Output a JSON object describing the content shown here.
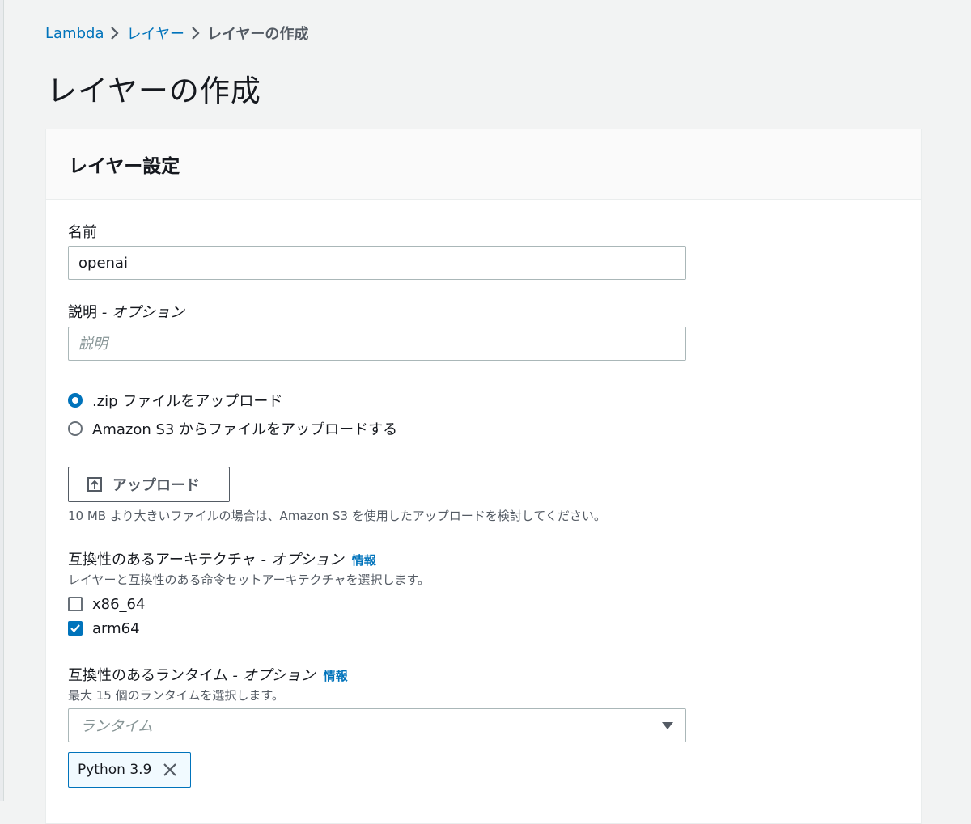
{
  "breadcrumb": {
    "items": [
      {
        "label": "Lambda"
      },
      {
        "label": "レイヤー"
      },
      {
        "label": "レイヤーの作成"
      }
    ]
  },
  "page": {
    "title": "レイヤーの作成"
  },
  "panel": {
    "header": "レイヤー設定",
    "name_field": {
      "label": "名前",
      "value": "openai"
    },
    "description_field": {
      "label": "説明",
      "optional": " - オプション",
      "placeholder": "説明"
    },
    "upload_options": [
      {
        "label": ".zip ファイルをアップロード",
        "selected": true
      },
      {
        "label": "Amazon S3 からファイルをアップロードする",
        "selected": false
      }
    ],
    "upload_button": {
      "label": "アップロード"
    },
    "upload_help": "10 MB より大きいファイルの場合は、Amazon S3 を使用したアップロードを検討してください。",
    "architectures": {
      "label": "互換性のあるアーキテクチャ",
      "optional": " - オプション",
      "info": "情報",
      "description": "レイヤーと互換性のある命令セットアーキテクチャを選択します。",
      "options": [
        {
          "label": "x86_64",
          "checked": false
        },
        {
          "label": "arm64",
          "checked": true
        }
      ]
    },
    "runtimes": {
      "label": "互換性のあるランタイム",
      "optional": " - オプション",
      "info": "情報",
      "description": "最大 15 個のランタイムを選択します。",
      "placeholder": "ランタイム",
      "selected_token": "Python 3.9"
    }
  },
  "colors": {
    "accent": "#0073bb",
    "background": "#f2f3f3",
    "text": "#16191f"
  }
}
